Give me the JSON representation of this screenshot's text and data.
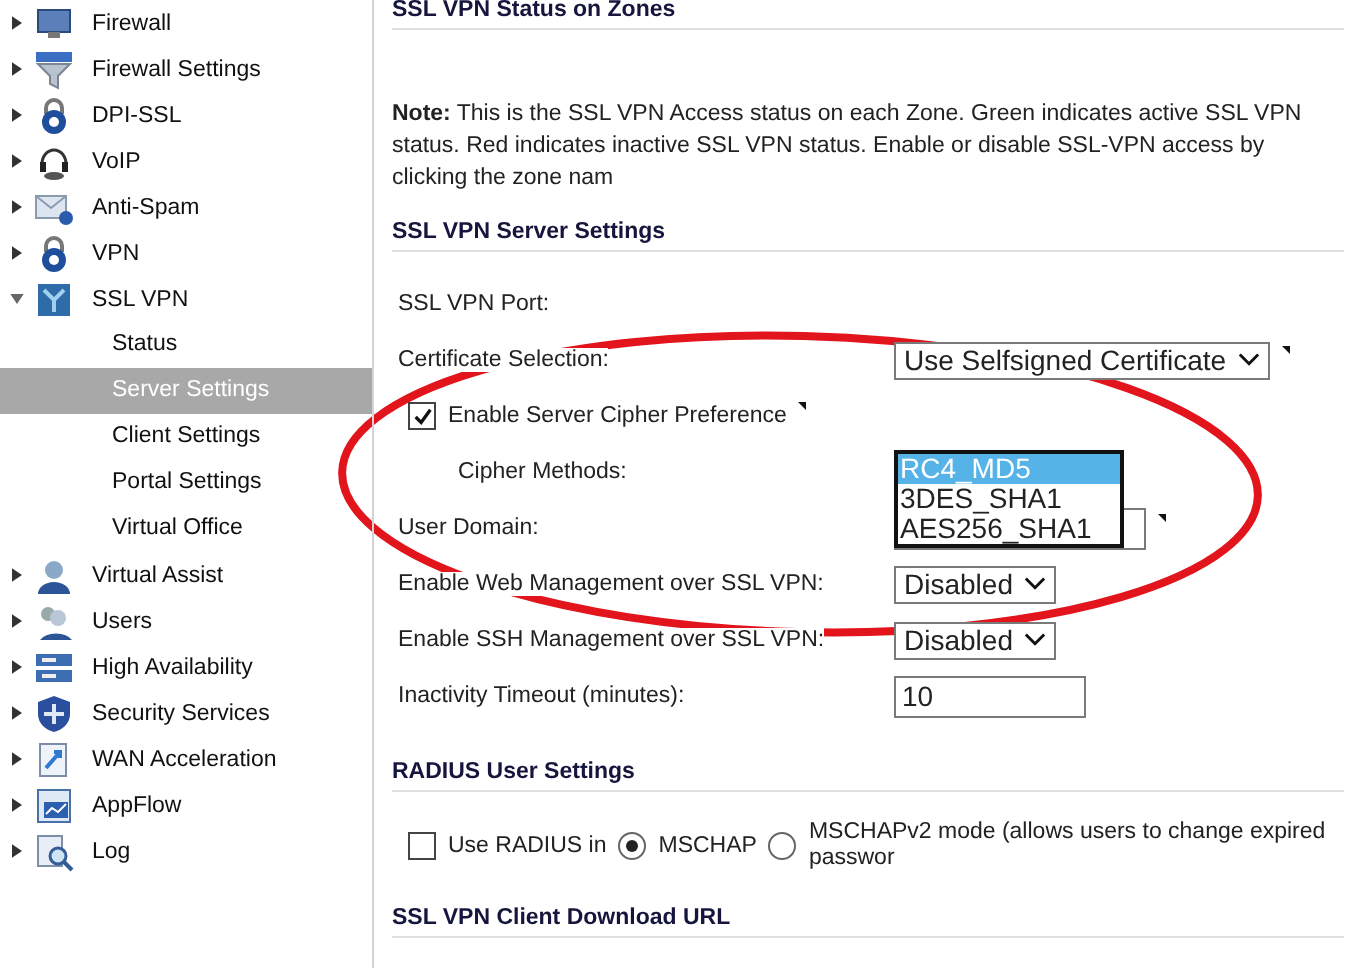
{
  "sidebar": {
    "items": [
      {
        "label": "Firewall",
        "expanded": false,
        "selected": false
      },
      {
        "label": "Firewall Settings",
        "expanded": false,
        "selected": false
      },
      {
        "label": "DPI-SSL",
        "expanded": false,
        "selected": false
      },
      {
        "label": "VoIP",
        "expanded": false,
        "selected": false
      },
      {
        "label": "Anti-Spam",
        "expanded": false,
        "selected": false
      },
      {
        "label": "VPN",
        "expanded": false,
        "selected": false
      },
      {
        "label": "SSL VPN",
        "expanded": true,
        "selected": false,
        "children": [
          {
            "label": "Status",
            "selected": false
          },
          {
            "label": "Server Settings",
            "selected": true
          },
          {
            "label": "Client Settings",
            "selected": false
          },
          {
            "label": "Portal Settings",
            "selected": false
          },
          {
            "label": "Virtual Office",
            "selected": false
          }
        ]
      },
      {
        "label": "Virtual Assist",
        "expanded": false,
        "selected": false
      },
      {
        "label": "Users",
        "expanded": false,
        "selected": false
      },
      {
        "label": "High Availability",
        "expanded": false,
        "selected": false
      },
      {
        "label": "Security Services",
        "expanded": false,
        "selected": false
      },
      {
        "label": "WAN Acceleration",
        "expanded": false,
        "selected": false
      },
      {
        "label": "AppFlow",
        "expanded": false,
        "selected": false
      },
      {
        "label": "Log",
        "expanded": false,
        "selected": false
      }
    ]
  },
  "status_zones": {
    "heading": "SSL VPN Status on Zones",
    "note": "**Note:** This is the SSL VPN Access status on each Zone. Green indicates active SSL VPN status. Red indicates inactive SSL VPN status. Enable or disable SSL-VPN access by clicking the zone nam"
  },
  "server_settings": {
    "heading": "SSL VPN Server Settings",
    "rows": [
      {
        "kind": "label",
        "label": "SSL VPN Port:"
      },
      {
        "kind": "select",
        "label": "Certificate Selection:",
        "value": "Use Selfsigned Certificate",
        "tip": true
      },
      {
        "kind": "checkbox",
        "label": "Enable Server Cipher Preference",
        "checked": true,
        "tip": true
      },
      {
        "kind": "listbox",
        "label": "Cipher Methods:",
        "options": [
          {
            "label": "RC4_MD5",
            "selected": true
          },
          {
            "label": "3DES_SHA1",
            "selected": false
          },
          {
            "label": "AES256_SHA1",
            "selected": false
          }
        ]
      },
      {
        "kind": "input",
        "label": "User Domain:",
        "tip": true
      },
      {
        "kind": "select",
        "label": "Enable Web Management over SSL VPN:",
        "value": "Disabled"
      },
      {
        "kind": "select",
        "label": "Enable SSH Management over SSL VPN:",
        "value": "Disabled"
      },
      {
        "kind": "input",
        "label": "Inactivity Timeout (minutes):",
        "value": "10"
      }
    ]
  },
  "radius": {
    "heading": "RADIUS User Settings",
    "use_radius": {
      "label": "Use RADIUS in",
      "checked": false
    },
    "modes": [
      {
        "label": "MSCHAP",
        "selected": true
      },
      {
        "label": "MSCHAPv2 mode (allows users to change expired passwor",
        "selected": false
      }
    ]
  },
  "download": {
    "heading": "SSL VPN Client Download URL"
  }
}
